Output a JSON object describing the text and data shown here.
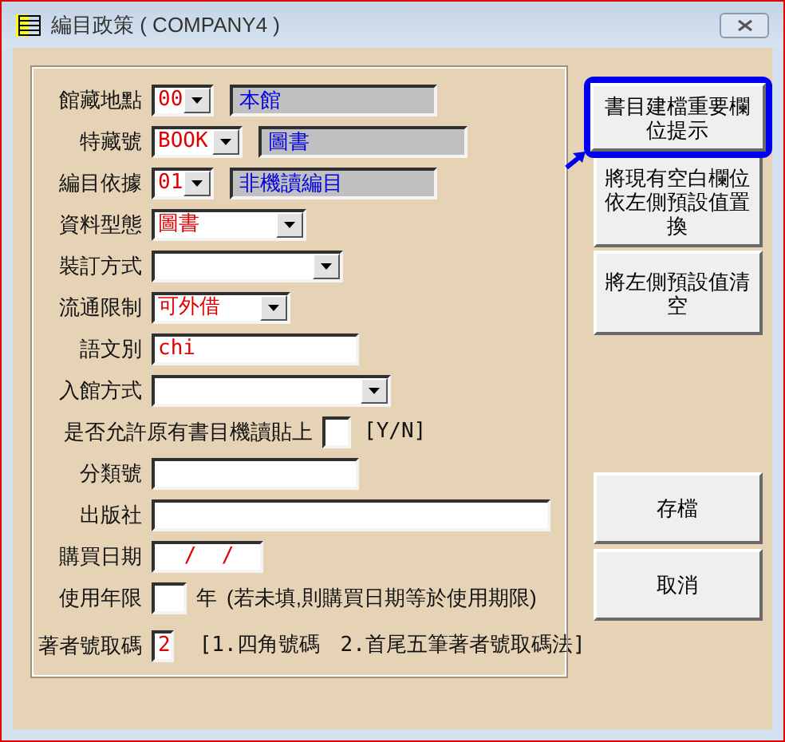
{
  "window": {
    "title": "編目政策 ( COMPANY4 )"
  },
  "fields": [
    {
      "kind": "combo_desc",
      "label": "館藏地點",
      "code": "00",
      "description": "本館"
    },
    {
      "kind": "combo_desc",
      "label": "特藏號",
      "code": "BOOK",
      "description": "圖書"
    },
    {
      "kind": "combo_desc",
      "label": "編目依據",
      "code": "01",
      "description": "非機讀編目"
    },
    {
      "kind": "combo",
      "label": "資料型態",
      "value": "圖書"
    },
    {
      "kind": "combo",
      "label": "裝訂方式"
    },
    {
      "kind": "combo",
      "label": "流通限制",
      "value": "可外借"
    },
    {
      "kind": "text",
      "label": "語文別",
      "value": "chi"
    },
    {
      "kind": "combo",
      "label": "入館方式"
    },
    {
      "kind": "flag",
      "label": "是否允許原有書目機讀貼上",
      "hint": "[Y/N]"
    },
    {
      "kind": "text",
      "label": "分類號"
    },
    {
      "kind": "text",
      "label": "出版社"
    },
    {
      "kind": "text",
      "label": "購買日期",
      "value": "/  /"
    },
    {
      "kind": "text",
      "label": "使用年限",
      "unit": "年",
      "hint": "(若未填,則購買日期等於使用期限)"
    },
    {
      "kind": "text",
      "label": "著者號取碼",
      "value": "2",
      "hint": "[1.四角號碼　2.首尾五筆著者號取碼法]"
    }
  ],
  "buttons": [
    {
      "label": "書目建檔重要欄位提示",
      "highlighted": true
    },
    {
      "label": "將現有空白欄位依左側預設值置換",
      "highlighted": false
    },
    {
      "label": "將左側預設值清空",
      "highlighted": false
    }
  ],
  "actions": [
    {
      "label": "存檔"
    },
    {
      "label": "取消"
    }
  ]
}
